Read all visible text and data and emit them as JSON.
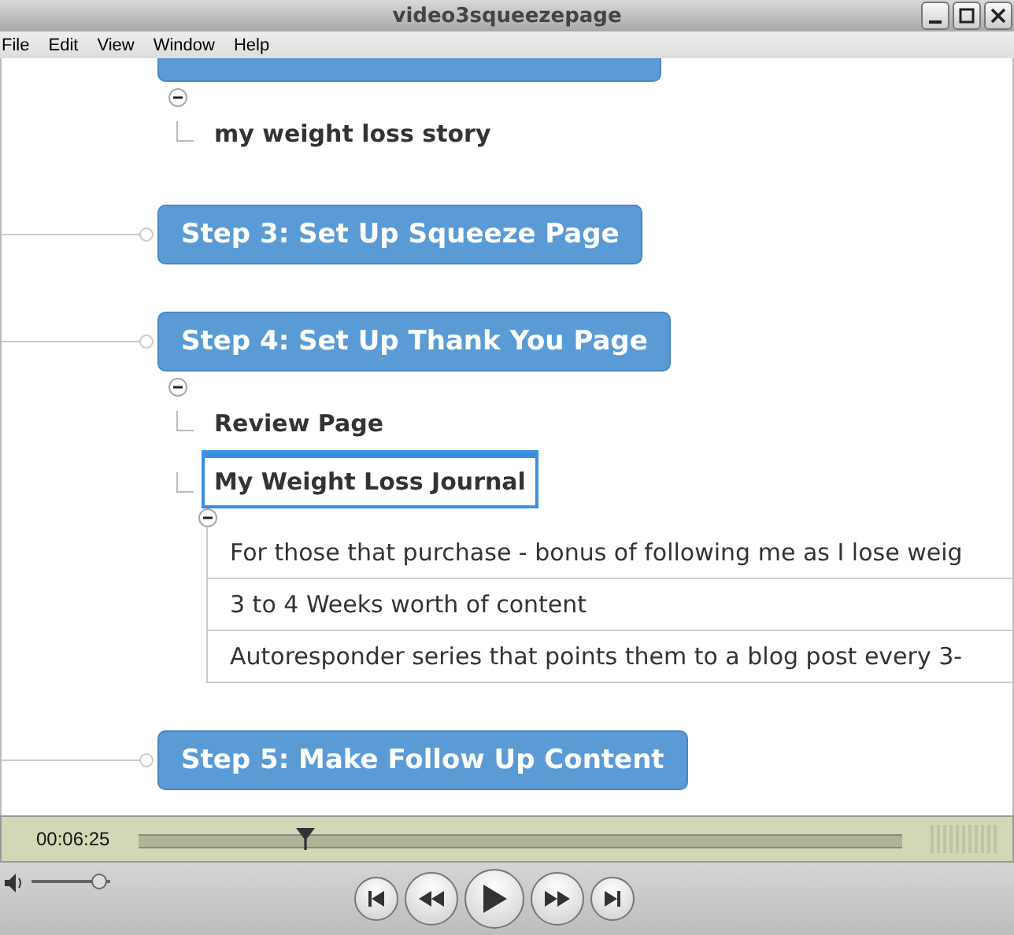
{
  "window": {
    "title": "video3squeezepage"
  },
  "menu": [
    "File",
    "Edit",
    "View",
    "Window",
    "Help"
  ],
  "steps": [
    {
      "expanded": true,
      "children": [
        {
          "label": "my weight loss story",
          "selected": false
        }
      ]
    },
    {
      "label": "Step 3: Set Up Squeeze Page"
    },
    {
      "label": "Step 4: Set Up Thank You Page",
      "expanded": true,
      "children": [
        {
          "label": "Review Page",
          "selected": false
        },
        {
          "label": "My Weight Loss Journal",
          "selected": true,
          "expanded": true,
          "notes": [
            "For those that purchase - bonus of following me as I lose weig",
            "3 to 4 Weeks worth of content",
            "Autoresponder series that points them to a blog post every 3-"
          ]
        }
      ]
    },
    {
      "label": "Step 5: Make Follow Up Content"
    }
  ],
  "player": {
    "time": "00:06:25",
    "position": {
      "level": 0.22
    },
    "volume": {
      "level": 0.95
    }
  }
}
